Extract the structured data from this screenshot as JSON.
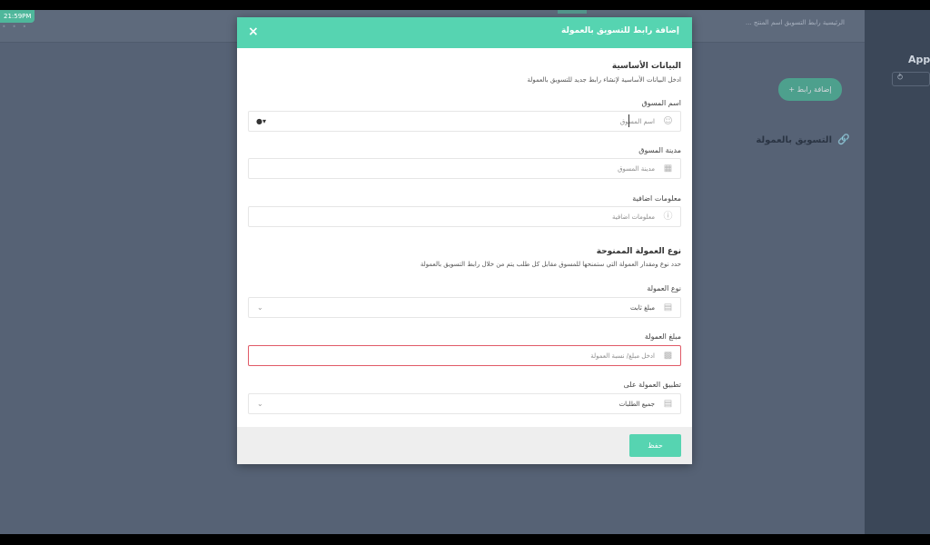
{
  "status_bar": {
    "time": "21:59PM"
  },
  "background": {
    "breadcrumb": "الرئيسية   رابط التسويق   اسم المنتج   ...",
    "app_title": "App",
    "add_button_label": "+ إضافة رابط",
    "card_title": "التسويق بالعمولة"
  },
  "modal": {
    "title": "إضافة رابط للتسويق بالعمولة",
    "close_icon": "×",
    "basic_section": {
      "title": "البيانات الأساسية",
      "description": "ادخل البيانات الأساسية لإنشاء رابط جديد للتسويق بالعمولة"
    },
    "marketer_name": {
      "label": "اسم المسوق",
      "placeholder": "اسم المسوق",
      "icon": "person-icon"
    },
    "marketer_city": {
      "label": "مدينة المسوق",
      "placeholder": "مدينة المسوق",
      "icon": "building-icon"
    },
    "extra_info": {
      "label": "معلومات اضافية",
      "placeholder": "معلومات اضافية",
      "icon": "info-icon"
    },
    "commission_section": {
      "title": "نوع العمولة الممنوحة",
      "description": "حدد نوع ومقدار العمولة التي ستمنحها للمسوق مقابل كل طلب يتم من خلال رابط التسويق بالعمولة"
    },
    "commission_type": {
      "label": "نوع العمولة",
      "value": "مبلغ ثابت",
      "icon": "document-icon"
    },
    "commission_amount": {
      "label": "مبلغ العمولة",
      "placeholder": "ادخل مبلغ/ نسبة العمولة",
      "icon": "money-icon"
    },
    "apply_on": {
      "label": "تطبيق العمولة على",
      "value": "جميع الطلبات",
      "icon": "document-icon"
    },
    "save_label": "حفظ"
  },
  "colors": {
    "accent": "#56d4b1",
    "error_border": "#e05a67",
    "backdrop": "#566275"
  }
}
